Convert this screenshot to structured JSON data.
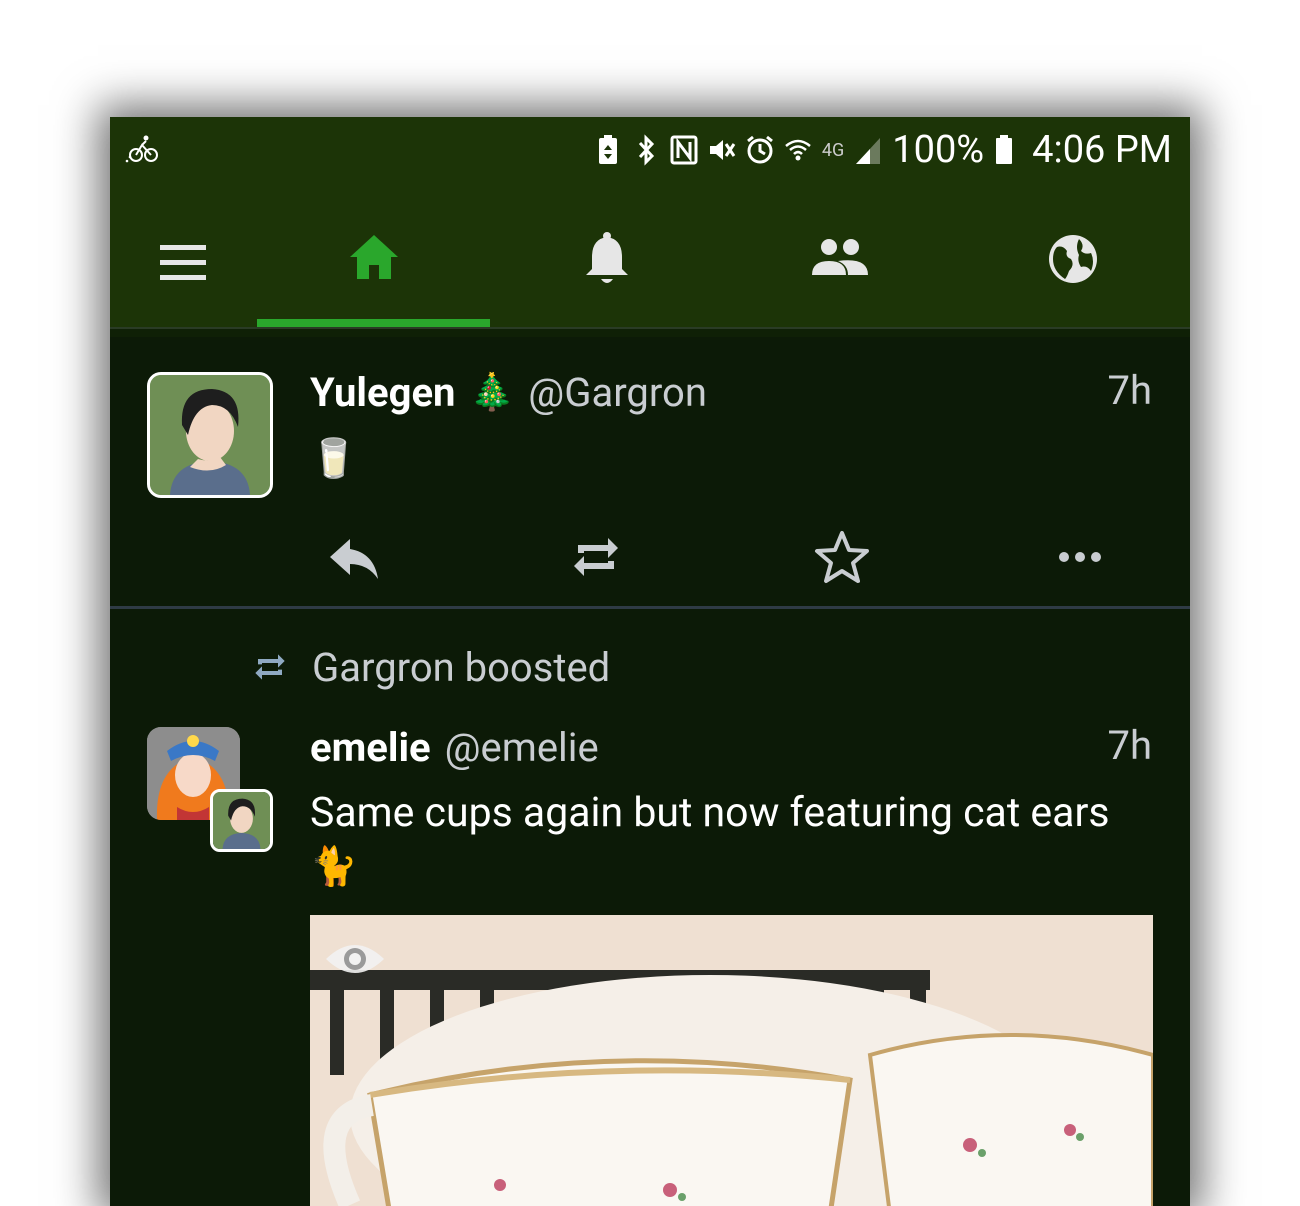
{
  "status_bar": {
    "battery": "100%",
    "time": "4:06 PM",
    "network": "4G"
  },
  "nav": {
    "tabs": [
      {
        "name": "home",
        "icon": "home-icon",
        "active": true
      },
      {
        "name": "notifications",
        "icon": "bell-icon",
        "active": false
      },
      {
        "name": "local",
        "icon": "people-icon",
        "active": false
      },
      {
        "name": "federated",
        "icon": "globe-icon",
        "active": false
      }
    ]
  },
  "colors": {
    "accent": "#2aa72c",
    "header_bg": "#1c3407",
    "timeline_bg": "#0c1a07",
    "secondary_text": "#c9cdd1"
  },
  "posts": [
    {
      "display_name": "Yulegen",
      "name_emoji": "🎄",
      "handle": "@Gargron",
      "time": "7h",
      "content": "🥛"
    },
    {
      "boosted_by": "Gargron boosted",
      "display_name": "emelie",
      "handle": "@emelie",
      "time": "7h",
      "content": "Same cups again but now featuring cat ears",
      "content_emoji": "🐈",
      "media": "photo of two floral teacups with cat ears peeking behind"
    }
  ]
}
